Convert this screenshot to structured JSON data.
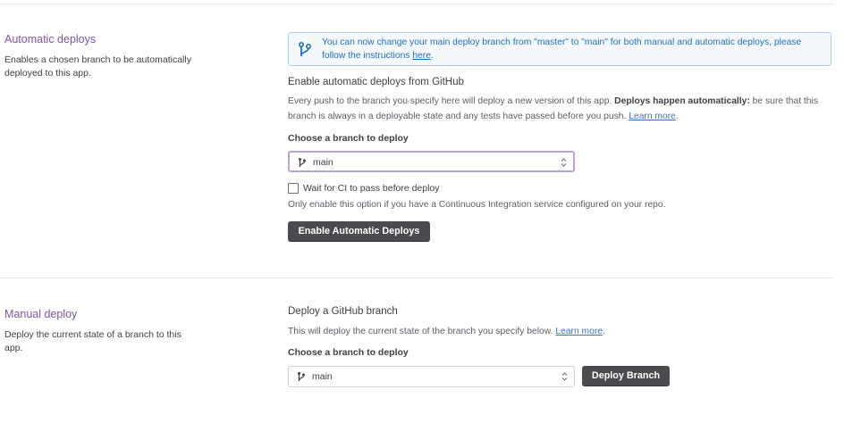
{
  "automatic": {
    "title": "Automatic deploys",
    "description": "Enables a chosen branch to be automatically deployed to this app.",
    "banner": {
      "text": "You can now change your main deploy branch from \"master\" to \"main\" for both manual and automatic deploys, please follow the instructions ",
      "link": "here",
      "suffix": "."
    },
    "heading": "Enable automatic deploys from GitHub",
    "body_start": "Every push to the branch you specify here will deploy a new version of this app. ",
    "body_bold": "Deploys happen automatically:",
    "body_end": " be sure that this branch is always in a deployable state and any tests have passed before you push. ",
    "learn_more": "Learn more",
    "learn_more_suffix": ".",
    "branch_label": "Choose a branch to deploy",
    "branch_value": "main",
    "ci_checkbox_label": "Wait for CI to pass before deploy",
    "ci_checked": false,
    "ci_help": "Only enable this option if you have a Continuous Integration service configured on your repo.",
    "enable_button": "Enable Automatic Deploys"
  },
  "manual": {
    "title": "Manual deploy",
    "description": "Deploy the current state of a branch to this app.",
    "heading": "Deploy a GitHub branch",
    "body": "This will deploy the current state of the branch you specify below. ",
    "learn_more": "Learn more",
    "learn_more_suffix": ".",
    "branch_label": "Choose a branch to deploy",
    "branch_value": "main",
    "deploy_button": "Deploy Branch"
  },
  "icons": {
    "banner": "git-branch-icon",
    "select": "git-branch-icon",
    "select_chevron": "chevron-updown-icon"
  },
  "colors": {
    "section_title": "#79589f",
    "banner_text": "#1f6fb8",
    "banner_bg": "#f5f9fd",
    "button_bg": "#4a4a4f",
    "focus_border": "#b9a3d6"
  }
}
